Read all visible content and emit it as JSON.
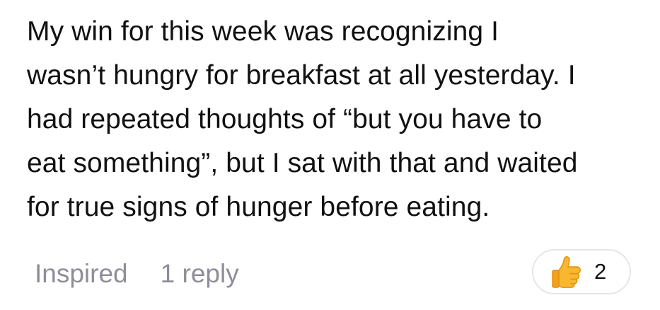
{
  "post": {
    "body_lines": [
      "My win for this week was recognizing I",
      "wasn’t hungry for breakfast at all yesterday.  I",
      "had repeated thoughts of “but you have to",
      "eat something”, but I sat with that and waited",
      "for true signs of hunger before eating."
    ]
  },
  "actions": {
    "inspired_label": "Inspired",
    "reply_label": "1 reply"
  },
  "reaction": {
    "icon": "thumbs-up-icon",
    "count": "2",
    "colors": {
      "thumb": "#f7b731",
      "thumb_outline": "#e08e0b",
      "muted_text": "#8e8e9a",
      "pill_border": "#e6e6ea"
    }
  }
}
